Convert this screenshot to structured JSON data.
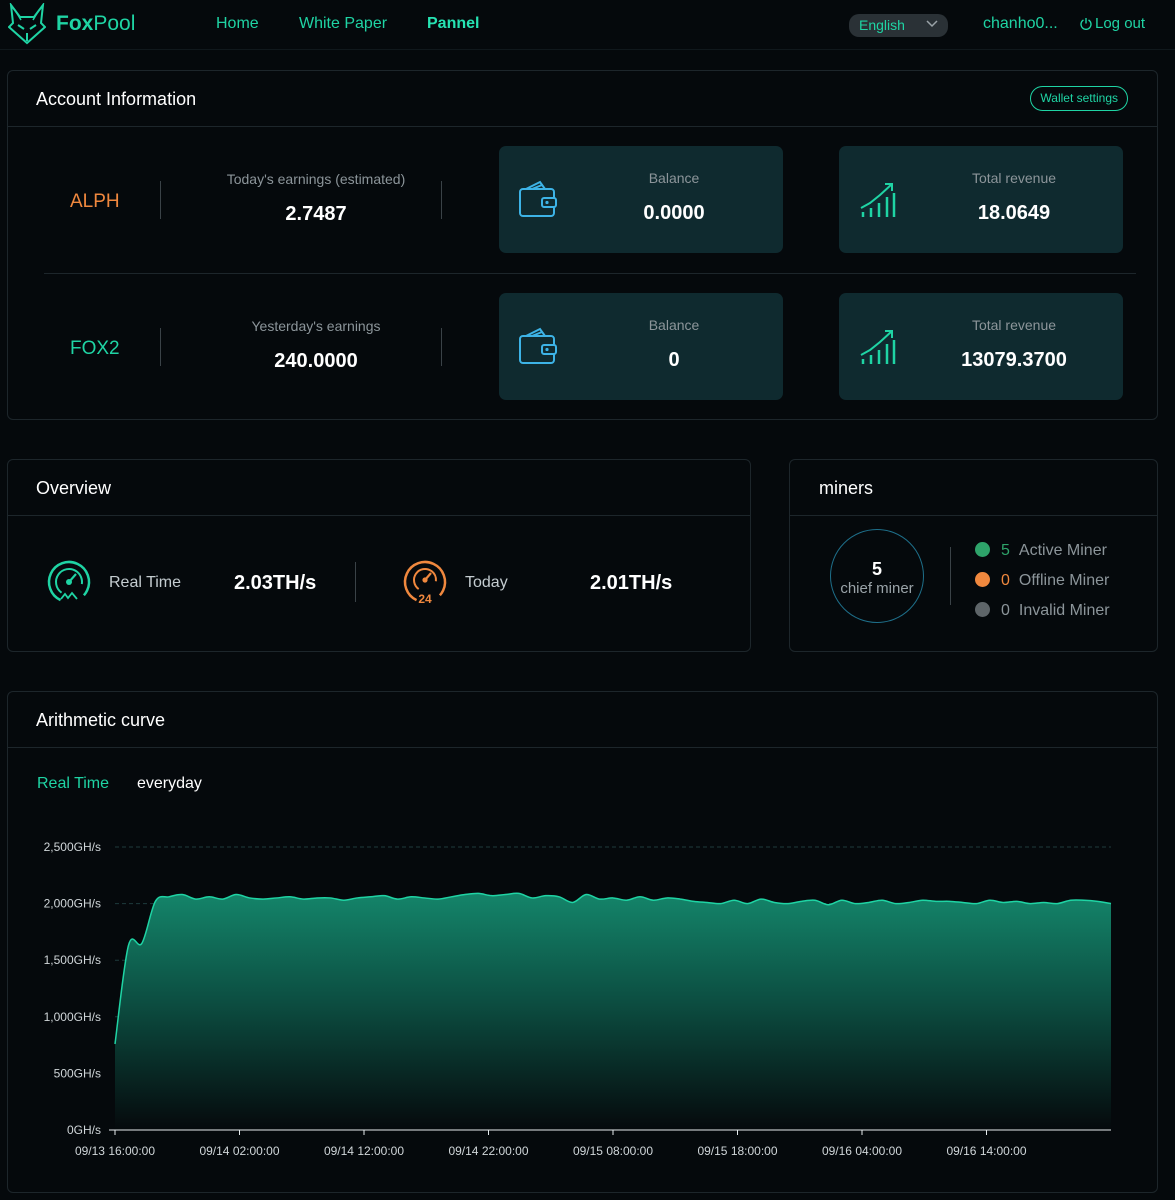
{
  "header": {
    "brand_fox": "Fox",
    "brand_pool": "Pool",
    "nav": [
      "Home",
      "White Paper",
      "Pannel"
    ],
    "language": "English",
    "user": "chanho0...",
    "logout": "Log out"
  },
  "account": {
    "title": "Account Information",
    "wallet_settings": "Wallet settings",
    "rows": [
      {
        "coin": "ALPH",
        "coin_color": "#f0883e",
        "earnings_label": "Today's earnings (estimated)",
        "earnings_value": "2.7487",
        "balance_label": "Balance",
        "balance_value": "0.0000",
        "revenue_label": "Total revenue",
        "revenue_value": "18.0649"
      },
      {
        "coin": "FOX2",
        "coin_color": "#1fd4a4",
        "earnings_label": "Yesterday's earnings",
        "earnings_value": "240.0000",
        "balance_label": "Balance",
        "balance_value": "0",
        "revenue_label": "Total revenue",
        "revenue_value": "13079.3700"
      }
    ]
  },
  "overview": {
    "title": "Overview",
    "realtime_label": "Real Time",
    "realtime_value": "2.03TH/s",
    "today_label": "Today",
    "today_value": "2.01TH/s",
    "today_badge": "24"
  },
  "miners": {
    "title": "miners",
    "chief_count": "5",
    "chief_label": "chief miner",
    "legend": [
      {
        "count": "5",
        "label": "Active Miner",
        "color": "#2ea36a",
        "count_color": "#2ea36a"
      },
      {
        "count": "0",
        "label": "Offline Miner",
        "color": "#f0883e",
        "count_color": "#f0883e"
      },
      {
        "count": "0",
        "label": "Invalid Miner",
        "color": "#5e6569",
        "count_color": "#8c959a"
      }
    ]
  },
  "curve": {
    "title": "Arithmetic curve",
    "tabs": [
      "Real Time",
      "everyday"
    ],
    "active_tab": "Real Time"
  },
  "chart_data": {
    "type": "area",
    "title": "",
    "xlabel": "",
    "ylabel": "",
    "y_unit": "GH/s",
    "ylim": [
      0,
      2500
    ],
    "y_ticks": [
      "0GH/s",
      "500GH/s",
      "1,000GH/s",
      "1,500GH/s",
      "2,000GH/s",
      "2,500GH/s"
    ],
    "x_ticks": [
      "09/13 16:00:00",
      "09/14 02:00:00",
      "09/14 12:00:00",
      "09/14 22:00:00",
      "09/15 08:00:00",
      "09/15 18:00:00",
      "09/16 04:00:00",
      "09/16 14:00:00"
    ],
    "grid": true,
    "series": [
      {
        "color": "#1fd4a4",
        "x": [
          "09/13 16:00",
          "09/13 17:00",
          "09/13 18:00",
          "09/13 19:00",
          "09/13 20:00",
          "09/13 21:00",
          "09/13 22:00",
          "09/13 23:00",
          "09/14 00:00",
          "09/14 01:00",
          "09/14 02:00",
          "09/14 03:00",
          "09/14 04:00",
          "09/14 05:00",
          "09/14 06:00",
          "09/14 07:00",
          "09/14 08:00",
          "09/14 09:00",
          "09/14 10:00",
          "09/14 11:00",
          "09/14 12:00",
          "09/14 13:00",
          "09/14 14:00",
          "09/14 15:00",
          "09/14 16:00",
          "09/14 17:00",
          "09/14 18:00",
          "09/14 19:00",
          "09/14 20:00",
          "09/14 21:00",
          "09/14 22:00",
          "09/14 23:00",
          "09/15 00:00",
          "09/15 01:00",
          "09/15 02:00",
          "09/15 03:00",
          "09/15 04:00",
          "09/15 05:00",
          "09/15 06:00",
          "09/15 07:00",
          "09/15 08:00",
          "09/15 09:00",
          "09/15 10:00",
          "09/15 11:00",
          "09/15 12:00",
          "09/15 13:00",
          "09/15 14:00",
          "09/15 15:00",
          "09/15 16:00",
          "09/15 17:00",
          "09/15 18:00",
          "09/15 19:00",
          "09/15 20:00",
          "09/15 21:00",
          "09/15 22:00",
          "09/15 23:00",
          "09/16 00:00",
          "09/16 01:00",
          "09/16 02:00",
          "09/16 03:00",
          "09/16 04:00",
          "09/16 05:00",
          "09/16 06:00",
          "09/16 07:00",
          "09/16 08:00",
          "09/16 09:00",
          "09/16 10:00",
          "09/16 11:00",
          "09/16 12:00",
          "09/16 13:00",
          "09/16 14:00",
          "09/16 15:00",
          "09/16 16:00",
          "09/16 17:00",
          "09/16 18:00"
        ],
        "values": [
          760,
          1630,
          1650,
          2020,
          2060,
          2080,
          2040,
          2060,
          2040,
          2080,
          2050,
          2040,
          2050,
          2060,
          2040,
          2050,
          2050,
          2030,
          2050,
          2060,
          2070,
          2040,
          2060,
          2050,
          2040,
          2060,
          2080,
          2090,
          2070,
          2080,
          2090,
          2050,
          2070,
          2060,
          2010,
          2080,
          2040,
          2050,
          2030,
          2060,
          2030,
          2050,
          2040,
          2020,
          2010,
          2000,
          2030,
          2000,
          2040,
          2010,
          2000,
          2020,
          2030,
          1990,
          2030,
          2000,
          2010,
          2030,
          2000,
          2010,
          2030,
          2020,
          2020,
          2010,
          2000,
          2030,
          2010,
          2020,
          2000,
          2010,
          2000,
          2030,
          2030,
          2020,
          2000
        ]
      }
    ]
  }
}
